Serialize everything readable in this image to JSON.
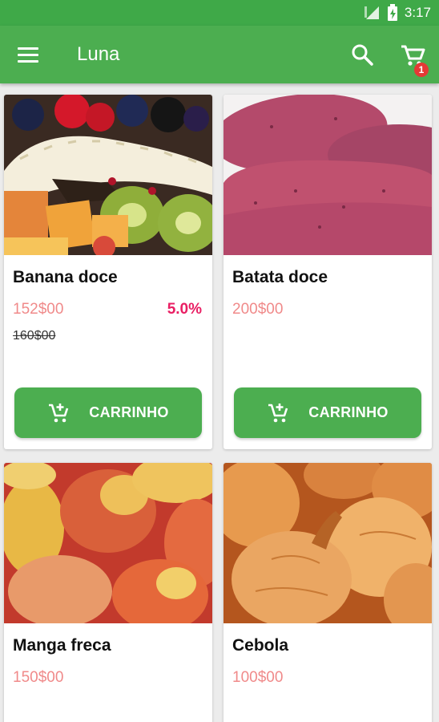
{
  "status_bar": {
    "clock": "3:17"
  },
  "app_bar": {
    "title": "Luna",
    "cart_count": "1"
  },
  "products": [
    {
      "name": "Banana doce",
      "price": "152$00",
      "discount": "5.0%",
      "old_price": "160$00",
      "cart_label": "CARRINHO",
      "image": "mixed-fruit-photo"
    },
    {
      "name": "Batata doce",
      "price": "200$00",
      "cart_label": "CARRINHO",
      "image": "sweet-potato-photo"
    },
    {
      "name": "Manga freca",
      "price": "150$00",
      "image": "mango-photo"
    },
    {
      "name": "Cebola",
      "price": "100$00",
      "image": "onion-photo"
    }
  ],
  "colors": {
    "primary": "#4cae50",
    "status_bar": "#3fa948",
    "price": "#f08a8a",
    "discount": "#e91e63",
    "badge": "#e53935"
  }
}
